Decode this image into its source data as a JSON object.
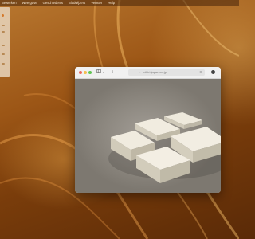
{
  "menubar": {
    "items": [
      "Bewerken",
      "Weergave",
      "Geschiedenis",
      "Bladwijzers",
      "Venster",
      "Help"
    ]
  },
  "browser": {
    "url": "mikiri-japan.co.jp",
    "icons": {
      "close": "close-dot",
      "minimize": "minimize-dot",
      "zoom": "zoom-dot",
      "sidebar": "sidebar-icon",
      "back": "chevron-left-icon",
      "lock": "lock-icon",
      "reader": "reader-icon",
      "share": "share-icon"
    }
  },
  "content": {
    "image": "paper-blocks-photo"
  },
  "colors": {
    "wallpaper": "#9c5616",
    "accent": "#d4792a"
  }
}
